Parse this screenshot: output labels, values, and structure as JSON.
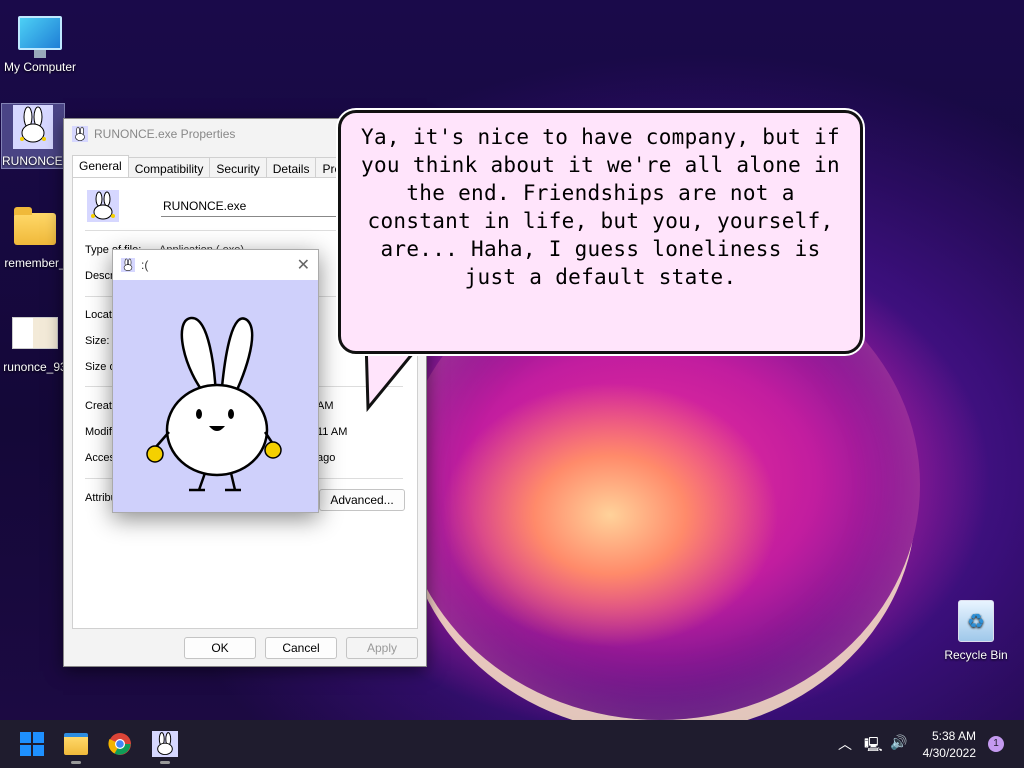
{
  "desktop": {
    "icons": [
      {
        "label": "My Computer",
        "icon": "computer-icon"
      },
      {
        "label": "RUNONCE.",
        "icon": "bunny-exe-icon"
      },
      {
        "label": "remember_",
        "icon": "folder-icon"
      },
      {
        "label": "runonce_93",
        "icon": "image-thumbnail-icon"
      },
      {
        "label": "Recycle Bin",
        "icon": "recycle-bin-icon"
      }
    ]
  },
  "properties": {
    "title": "RUNONCE.exe Properties",
    "tabs": [
      "General",
      "Compatibility",
      "Security",
      "Details",
      "Previous"
    ],
    "filename": "RUNONCE.exe",
    "rows": {
      "type": "Type of file:",
      "type_value": "Application (.exe)",
      "desc": "Descr",
      "loc": "Locati",
      "size": "Size:",
      "size_on": "Size o",
      "created": "Create",
      "created_val": "AM",
      "modified": "Modifi",
      "modified_val": "11 AM",
      "accessed": "Acces",
      "accessed_val": "ago",
      "attrib": "Attribu"
    },
    "advanced_label": "Advanced...",
    "ok_label": "OK",
    "cancel_label": "Cancel",
    "apply_label": "Apply"
  },
  "sad_window": {
    "title": ":("
  },
  "bubble": {
    "text": "Ya, it's nice to have company, but if you think about it we're all alone in the end. Friendships are not a constant in life, but you, yourself, are... Haha, I guess loneliness is just a default state."
  },
  "taskbar": {
    "apps": [
      "start-icon",
      "file-explorer-icon",
      "chrome-icon",
      "bunny-app-icon"
    ],
    "time": "5:38 AM",
    "date": "4/30/2022",
    "notifications": "1"
  },
  "colors": {
    "bubble": "#ffe4fb",
    "sad_bg": "#cfd0fb",
    "taskbar": "#1f1c2e"
  }
}
